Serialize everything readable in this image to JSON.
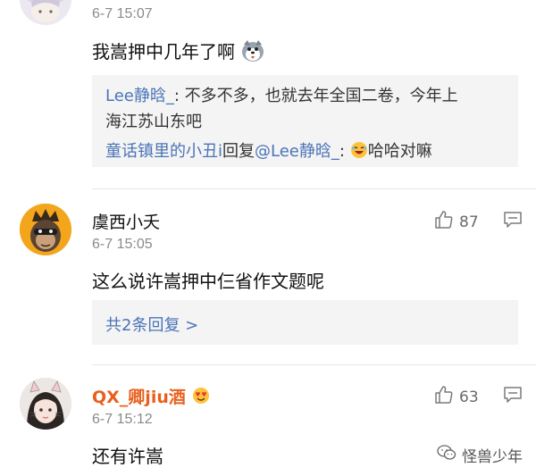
{
  "comment1": {
    "timestamp": "6-7 15:07",
    "text": "我嵩押中几年了啊",
    "replies": {
      "line1_user": "Lee静晗_",
      "line1_text": ": 不多不多，也就去年全国二卷，今年上",
      "line2_text": "海江苏山东吧",
      "line3_user": "童话镇里的小丑i",
      "line3_mid": "回复",
      "line3_mention": "@Lee静晗_",
      "line3_colon": ":",
      "line3_text": "哈哈对嘛"
    }
  },
  "comment2": {
    "username": "虞西小夭",
    "timestamp": "6-7 15:05",
    "likes": "87",
    "text": "这么说许嵩押中仨省作文题呢",
    "more_replies": "共2条回复 >"
  },
  "comment3": {
    "username": "QX_卿jiu酒",
    "timestamp": "6-7 15:12",
    "likes": "63",
    "text": "还有许嵩"
  },
  "watermark": {
    "text": "怪兽少年"
  },
  "colors": {
    "link": "#4a74b8",
    "vip_name": "#e8601c",
    "reply_bg": "#f4f4f4"
  }
}
